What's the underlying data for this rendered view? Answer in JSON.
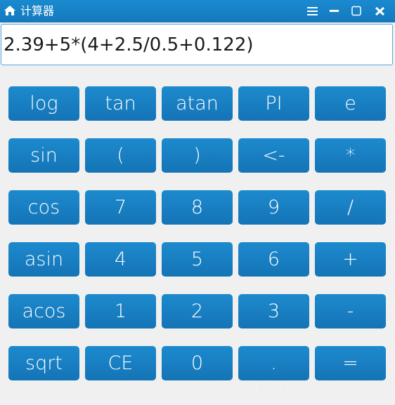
{
  "window": {
    "title": "计算器",
    "icons": {
      "app": "home-icon",
      "menu": "hamburger-menu-icon",
      "minimize": "minimize-icon",
      "maximize": "maximize-icon",
      "close": "close-icon"
    }
  },
  "display": {
    "value": "2.39+5*(4+2.5/0.5+0.122)"
  },
  "keypad": {
    "rows": [
      [
        "log",
        "tan",
        "atan",
        "PI",
        "e"
      ],
      [
        "sin",
        "(",
        ")",
        "<-",
        "*"
      ],
      [
        "cos",
        "7",
        "8",
        "9",
        "/"
      ],
      [
        "asin",
        "4",
        "5",
        "6",
        "+"
      ],
      [
        "acos",
        "1",
        "2",
        "3",
        "-"
      ],
      [
        "sqrt",
        "CE",
        "0",
        ".",
        "="
      ]
    ]
  },
  "watermark": "https://blog.csdn.net/qq_46068864",
  "colors": {
    "titlebar": "#1a8ad0",
    "button": "#1a82c5",
    "display_border": "#5aa3e0",
    "background": "#f0f0f0"
  }
}
